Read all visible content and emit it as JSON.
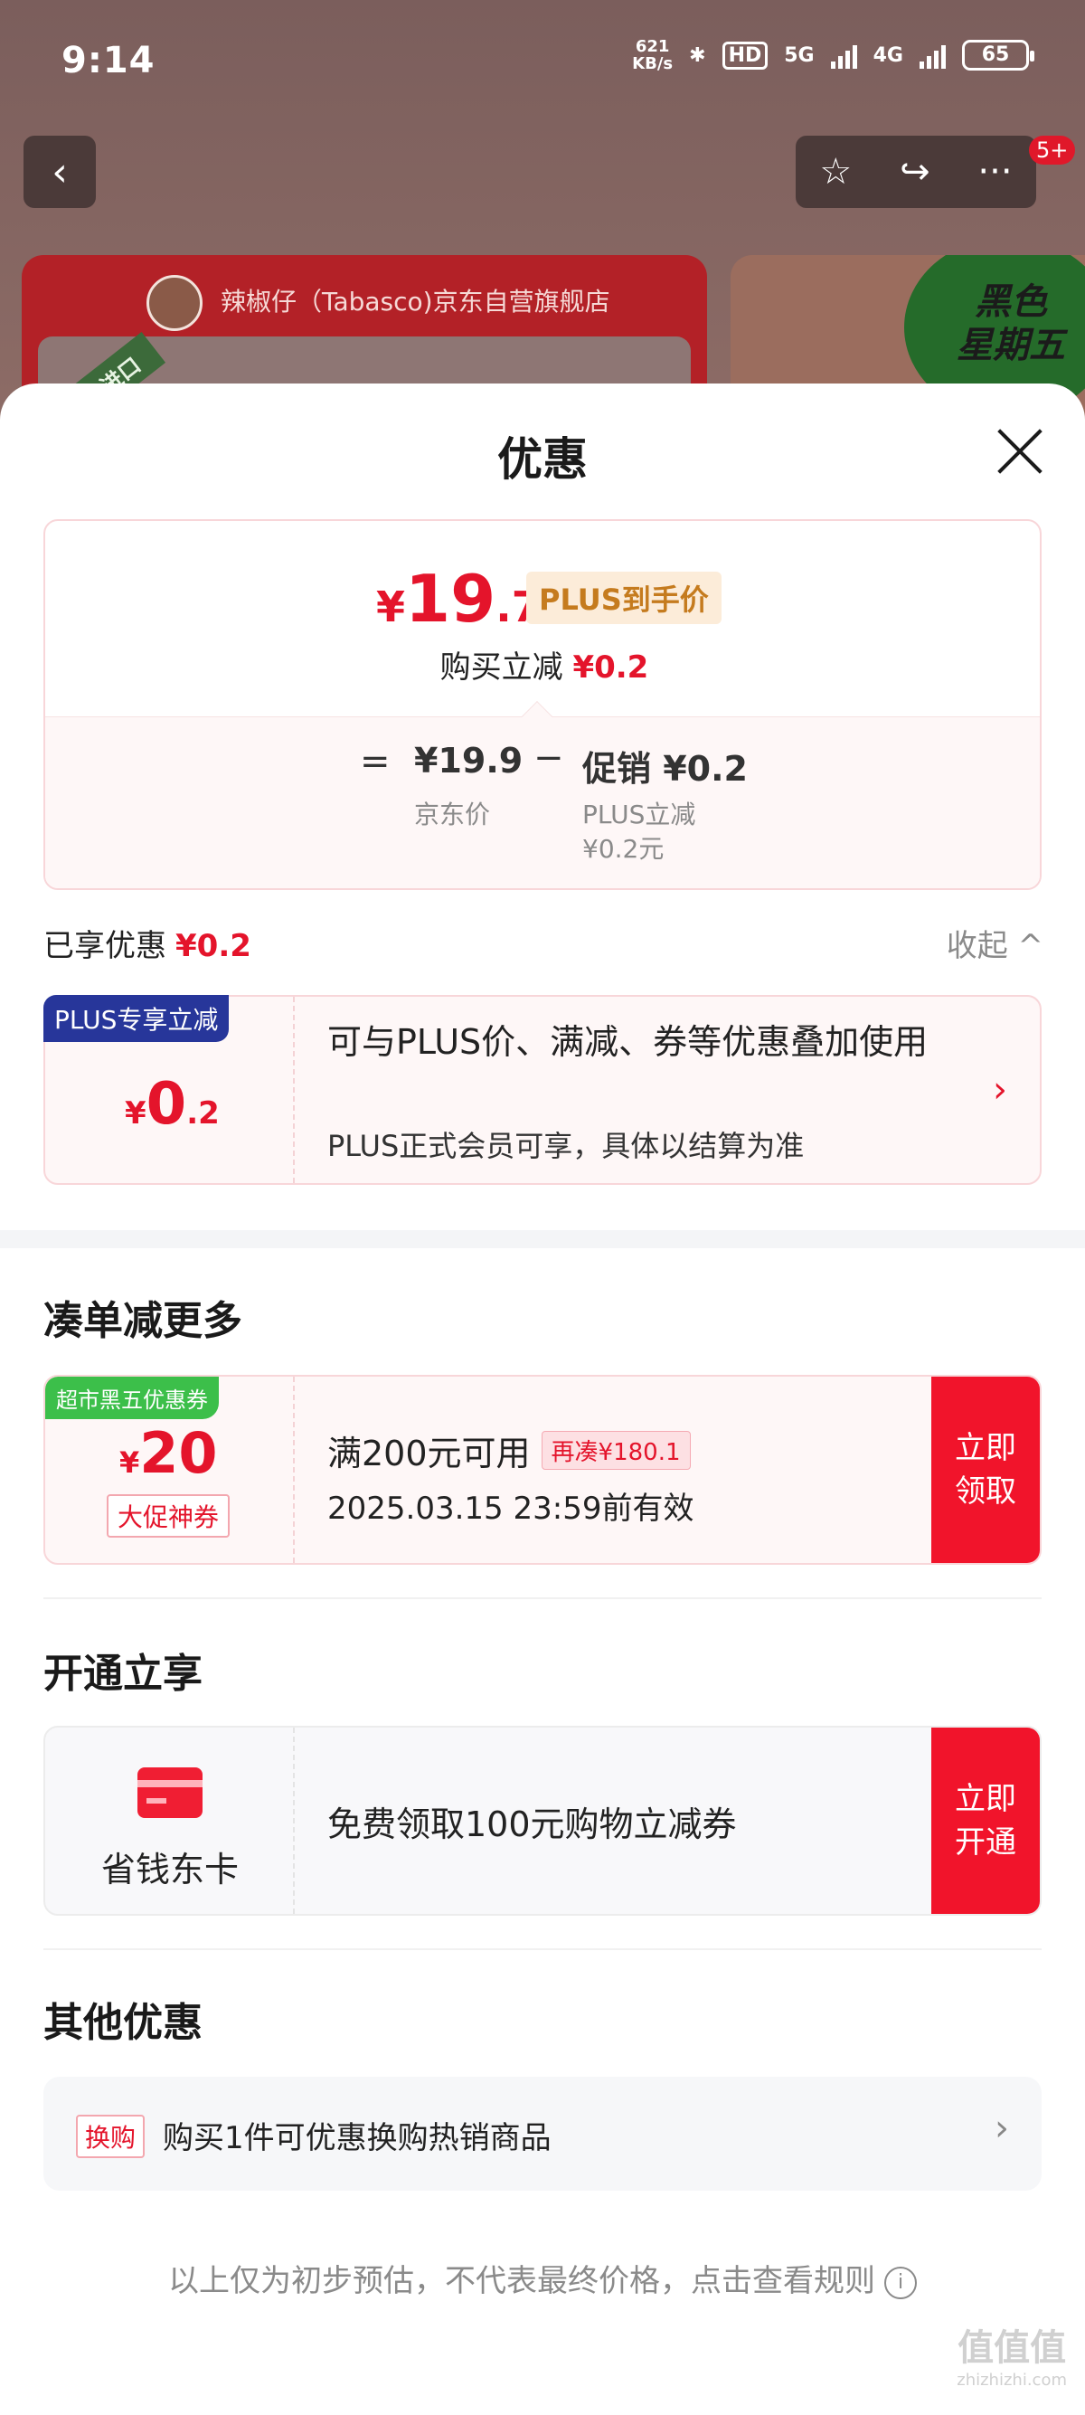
{
  "status_bar": {
    "time": "9:14",
    "net_speed": "621",
    "net_unit": "KB/s",
    "hd": "HD",
    "signal1": "5G",
    "signal2": "4G",
    "battery": "65"
  },
  "background": {
    "back_icon": "‹",
    "favorite_icon": "☆",
    "share_icon": "↪",
    "more_icon": "···",
    "badge": "5+",
    "store_name": "辣椒仔（Tabasco)京东自营旗舰店",
    "ribbon": "进口",
    "promo_text": "黑色\n星期五"
  },
  "sheet": {
    "title": "优惠",
    "price": {
      "yen": "¥",
      "int": "19",
      "dec": ".7",
      "tag": "PLUS到手价",
      "reduce_label": "购买立减",
      "reduce_value": "¥0.2"
    },
    "breakdown": {
      "eq": "=",
      "jd_price": "¥19.9",
      "jd_label": "京东价",
      "minus": "−",
      "promo_price": "促销 ¥0.2",
      "promo_sub1": "PLUS立减",
      "promo_sub2": "¥0.2元"
    },
    "enjoyed_label": "已享优惠",
    "enjoyed_value": "¥0.2",
    "collapse_label": "收起 ^",
    "plus_card": {
      "badge": "PLUS专享立减",
      "yen": "¥",
      "int": "0",
      "dec": ".2",
      "desc": "可与PLUS价、满减、券等优惠叠加使用",
      "note": "PLUS正式会员可享，具体以结算为准",
      "arrow": "›"
    },
    "section_more": "凑单减更多",
    "coupon": {
      "badge": "超市黑五优惠券",
      "yen": "¥",
      "int": "20",
      "kind": "大促神券",
      "cond": "满200元可用",
      "chip": "再凑¥180.1",
      "date": "2025.03.15 23:59前有效",
      "action": "立即\n领取"
    },
    "section_open": "开通立享",
    "open_card": {
      "name": "省钱东卡",
      "desc": "免费领取100元购物立减券",
      "action": "立即\n开通"
    },
    "section_other": "其他优惠",
    "exchange": {
      "chip": "换购",
      "text": "购买1件可优惠换购热销商品",
      "arrow": "›"
    },
    "footer": "以上仅为初步预估，不代表最终价格，点击查看规则",
    "footer_icon": "i"
  },
  "watermark": {
    "main": "值值值",
    "sub": "zhizhizhi.com"
  }
}
